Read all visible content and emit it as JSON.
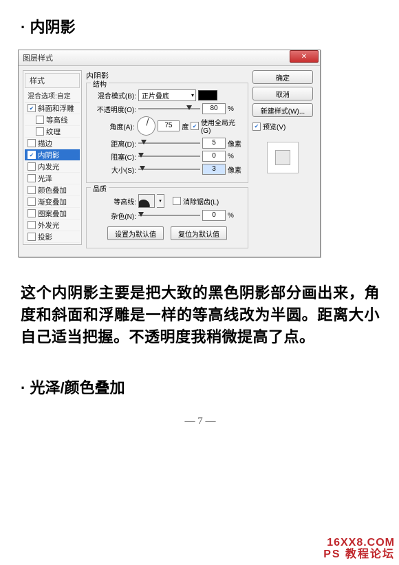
{
  "heading1": "· 内阴影",
  "dialog": {
    "title": "图层样式",
    "close": "✕",
    "styles_title": "样式",
    "blend_default": "混合选项:自定",
    "items": [
      {
        "label": "斜面和浮雕",
        "checked": true,
        "sel": false,
        "indent": 0
      },
      {
        "label": "等高线",
        "checked": false,
        "sel": false,
        "indent": 1
      },
      {
        "label": "纹理",
        "checked": false,
        "sel": false,
        "indent": 1
      },
      {
        "label": "描边",
        "checked": false,
        "sel": false,
        "indent": 0
      },
      {
        "label": "内阴影",
        "checked": true,
        "sel": true,
        "indent": 0
      },
      {
        "label": "内发光",
        "checked": false,
        "sel": false,
        "indent": 0
      },
      {
        "label": "光泽",
        "checked": false,
        "sel": false,
        "indent": 0
      },
      {
        "label": "颜色叠加",
        "checked": false,
        "sel": false,
        "indent": 0
      },
      {
        "label": "渐变叠加",
        "checked": false,
        "sel": false,
        "indent": 0
      },
      {
        "label": "图案叠加",
        "checked": false,
        "sel": false,
        "indent": 0
      },
      {
        "label": "外发光",
        "checked": false,
        "sel": false,
        "indent": 0
      },
      {
        "label": "投影",
        "checked": false,
        "sel": false,
        "indent": 0
      }
    ],
    "panel_title": "内阴影",
    "structure_title": "结构",
    "blend_mode_label": "混合模式(B):",
    "blend_mode_value": "正片叠底",
    "opacity_label": "不透明度(O):",
    "opacity_value": "80",
    "percent": "%",
    "angle_label": "角度(A):",
    "angle_value": "75",
    "degree": "度",
    "use_global_label": "使用全局光(G)",
    "distance_label": "距离(D):",
    "distance_value": "5",
    "px": "像素",
    "choke_label": "阻塞(C):",
    "choke_value": "0",
    "size_label": "大小(S):",
    "size_value": "3",
    "quality_title": "品质",
    "contour_label": "等高线:",
    "anti_alias_label": "消除锯齿(L)",
    "noise_label": "杂色(N):",
    "noise_value": "0",
    "make_default": "设置为默认值",
    "reset_default": "复位为默认值",
    "ok": "确定",
    "cancel": "取消",
    "new_style": "新建样式(W)...",
    "preview_label": "预览(V)"
  },
  "paragraph": "这个内阴影主要是把大致的黑色阴影部分画出来，角度和斜面和浮雕是一样的等高线改为半圆。距离大小自己适当把握。不透明度我稍微提高了点。",
  "heading2": "· 光泽/颜色叠加",
  "page_num": "— 7 —",
  "wm1": "16XX8.COM",
  "wm2": "PS 教程论坛"
}
